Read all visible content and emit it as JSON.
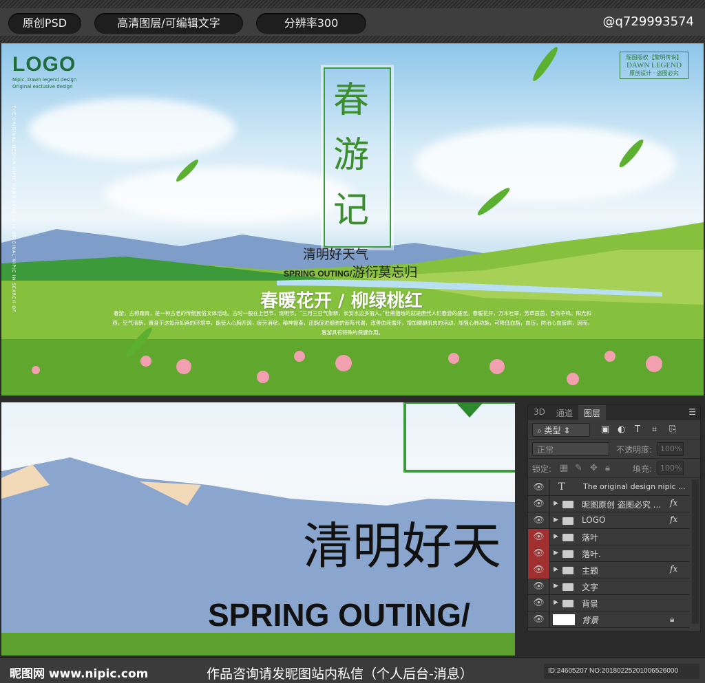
{
  "topbar": {
    "badges": [
      "原创PSD",
      "高清图层/可编辑文字",
      "分辨率300"
    ],
    "handle": "@q729993574"
  },
  "poster": {
    "logo": "LOGO",
    "logo_sub1": "Nipic. Dawn legend design",
    "logo_sub2": "Original exclusive design",
    "stamp_top": "昵图版权 ·【黎明传说】",
    "stamp_main": "DAWN LEGEND",
    "stamp_bottom": "原创设计 · 盗图必究",
    "vertical_text": "THE ORIGINAL DESIGN NIPIC DAWN LEGEND IS ORIGINAL NIPIC IN SEARCH OF",
    "title_chars": [
      "春",
      "游",
      "记"
    ],
    "subtitle1": "清明好天气",
    "spring": "SPRING OUTING/",
    "subtitle2": "游衍莫忘归",
    "slogan": "春暖花开 / 柳绿桃红",
    "paragraph": "春游，古称踏青，是一种古老的传统民俗文体活动。古时一般在上巳节，清明节。“三月三日气象新，长安水边多丽人。”杜甫描绘的就是唐代人们春游的盛况。春暖花开，万木吐翠，芳草茵茵，百鸟争鸣，阳光和煦，空气清新，置身于这如诗如画的环境中，能使人心胸开阔，疲劳消除，精神振奋，还能促进细胞的新陈代谢，改善血液循环，增加腰腿肌肉的活动，加强心肺功能，可降低血脂，血压，防治心血管病，因而，春游具有特殊的保健作用。"
  },
  "detail": {
    "big_text": "清明好天",
    "big_spring": "SPRING OUTING/"
  },
  "panel": {
    "tabs": [
      "3D",
      "通道",
      "图层"
    ],
    "filter": "类型",
    "blend": "正常",
    "opacity_label": "不透明度:",
    "opacity": "100%",
    "lock_label": "锁定:",
    "fill_label": "填充:",
    "fill": "100%",
    "layers": [
      {
        "name": "The original design nipic ...",
        "type": "text",
        "red": false,
        "fx": ""
      },
      {
        "name": "昵图原创 盗图必究 ...",
        "type": "folder",
        "red": false,
        "fx": "fx"
      },
      {
        "name": "LOGO",
        "type": "folder",
        "red": false,
        "fx": "fx"
      },
      {
        "name": "落叶",
        "type": "folder",
        "red": true,
        "fx": ""
      },
      {
        "name": "落叶.",
        "type": "folder",
        "red": true,
        "fx": ""
      },
      {
        "name": "主题",
        "type": "folder",
        "red": true,
        "fx": "fx"
      },
      {
        "name": "文字",
        "type": "folder",
        "red": false,
        "fx": ""
      },
      {
        "name": "背景",
        "type": "folder",
        "red": false,
        "fx": ""
      },
      {
        "name": "背景",
        "type": "background",
        "red": false,
        "fx": ""
      }
    ]
  },
  "footer": {
    "site": "昵图网 www.nipic.com",
    "notice": "作品咨询请发昵图站内私信（个人后台-消息）",
    "id": "ID:24605207 NO:20180225201006526000"
  }
}
